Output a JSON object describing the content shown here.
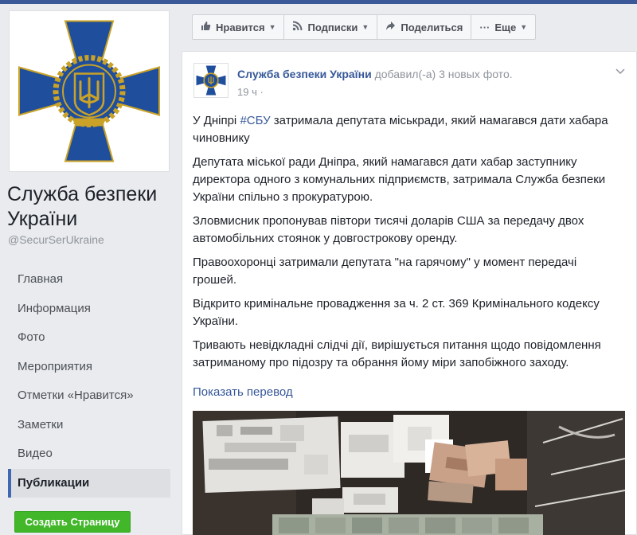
{
  "page": {
    "name": "Служба безпеки України",
    "handle": "@SecurSerUkraine"
  },
  "nav": {
    "items": [
      {
        "label": "Главная"
      },
      {
        "label": "Информация"
      },
      {
        "label": "Фото"
      },
      {
        "label": "Мероприятия"
      },
      {
        "label": "Отметки «Нравится»"
      },
      {
        "label": "Заметки"
      },
      {
        "label": "Видео"
      },
      {
        "label": "Публикации"
      }
    ],
    "active_index": 7,
    "create_page_label": "Создать Страницу"
  },
  "actions": {
    "like": "Нравится",
    "follow": "Подписки",
    "share": "Поделиться",
    "more": "Еще"
  },
  "post": {
    "author": "Служба безпеки України",
    "action_text": "добавил(-а) 3 новых фото.",
    "time": "19 ч",
    "body": {
      "p1_prefix": "У Дніпрі ",
      "p1_hashtag": "#СБУ",
      "p1_suffix": " затримала депутата міськради, який намагався дати хабара чиновнику",
      "p2": "Депутата міської ради Дніпра, який намагався дати хабар заступнику директора одного з комунальних підприємств, затримала Служба безпеки України спільно з прокуратурою.",
      "p3": "Зловмисник пропонував півтори тисячі доларів США за передачу двох автомобільних стоянок у довгострокову оренду.",
      "p4": "Правоохоронці затримали депутата \"на гарячому\" у момент передачі грошей.",
      "p5": "Відкрито кримінальне провадження за ч. 2 ст. 369 Кримінального кодексу України.",
      "p6": "Тривають невідкладні слідчі дії, вирішується питання щодо повідомлення затриманому про підозру та обрання йому міри запобіжного заходу."
    },
    "translate_link": "Показать перевод"
  },
  "colors": {
    "facebook_blue": "#3b5998",
    "link_blue": "#365899",
    "emblem_blue": "#1f4e9c",
    "emblem_gold": "#c9a227",
    "create_green": "#42b72a"
  }
}
